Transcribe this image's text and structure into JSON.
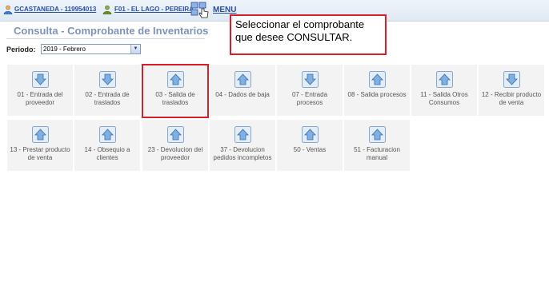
{
  "header": {
    "user": "GCASTANEDA - 119954013",
    "store": "F01 - EL LAGO - PEREIRA",
    "menu": "MENU"
  },
  "page": {
    "title": "Consulta - Comprobante de Inventarios",
    "periodo_label": "Periodo:",
    "periodo_value": "2019 - Febrero"
  },
  "tiles": [
    {
      "label": "01 - Entrada del proveedor",
      "arrow": "down"
    },
    {
      "label": "02 - Entrada de traslados",
      "arrow": "down"
    },
    {
      "label": "03 - Salida de traslados",
      "arrow": "up"
    },
    {
      "label": "04 - Dados de baja",
      "arrow": "up"
    },
    {
      "label": "07 - Entrada procesos",
      "arrow": "down"
    },
    {
      "label": "08 - Salida procesos",
      "arrow": "up"
    },
    {
      "label": "11 - Salida Otros Consumos",
      "arrow": "up"
    },
    {
      "label": "12 - Recibir producto de venta",
      "arrow": "down"
    },
    {
      "label": "13 - Prestar producto de venta",
      "arrow": "up"
    },
    {
      "label": "14 - Obsequio a clientes",
      "arrow": "up"
    },
    {
      "label": "23 - Devolucion del proveedor",
      "arrow": "up"
    },
    {
      "label": "37 - Devolucion pedidos incompletos",
      "arrow": "up"
    },
    {
      "label": "50 - Ventas",
      "arrow": "up"
    },
    {
      "label": "51 - Facturacion manual",
      "arrow": "up"
    }
  ],
  "callout": {
    "text": "Seleccionar el comprobante\nque desee  CONSULTAR."
  },
  "colors": {
    "highlight": "#d91e2a",
    "title": "#7e93b8",
    "link": "#2a4fa0"
  }
}
